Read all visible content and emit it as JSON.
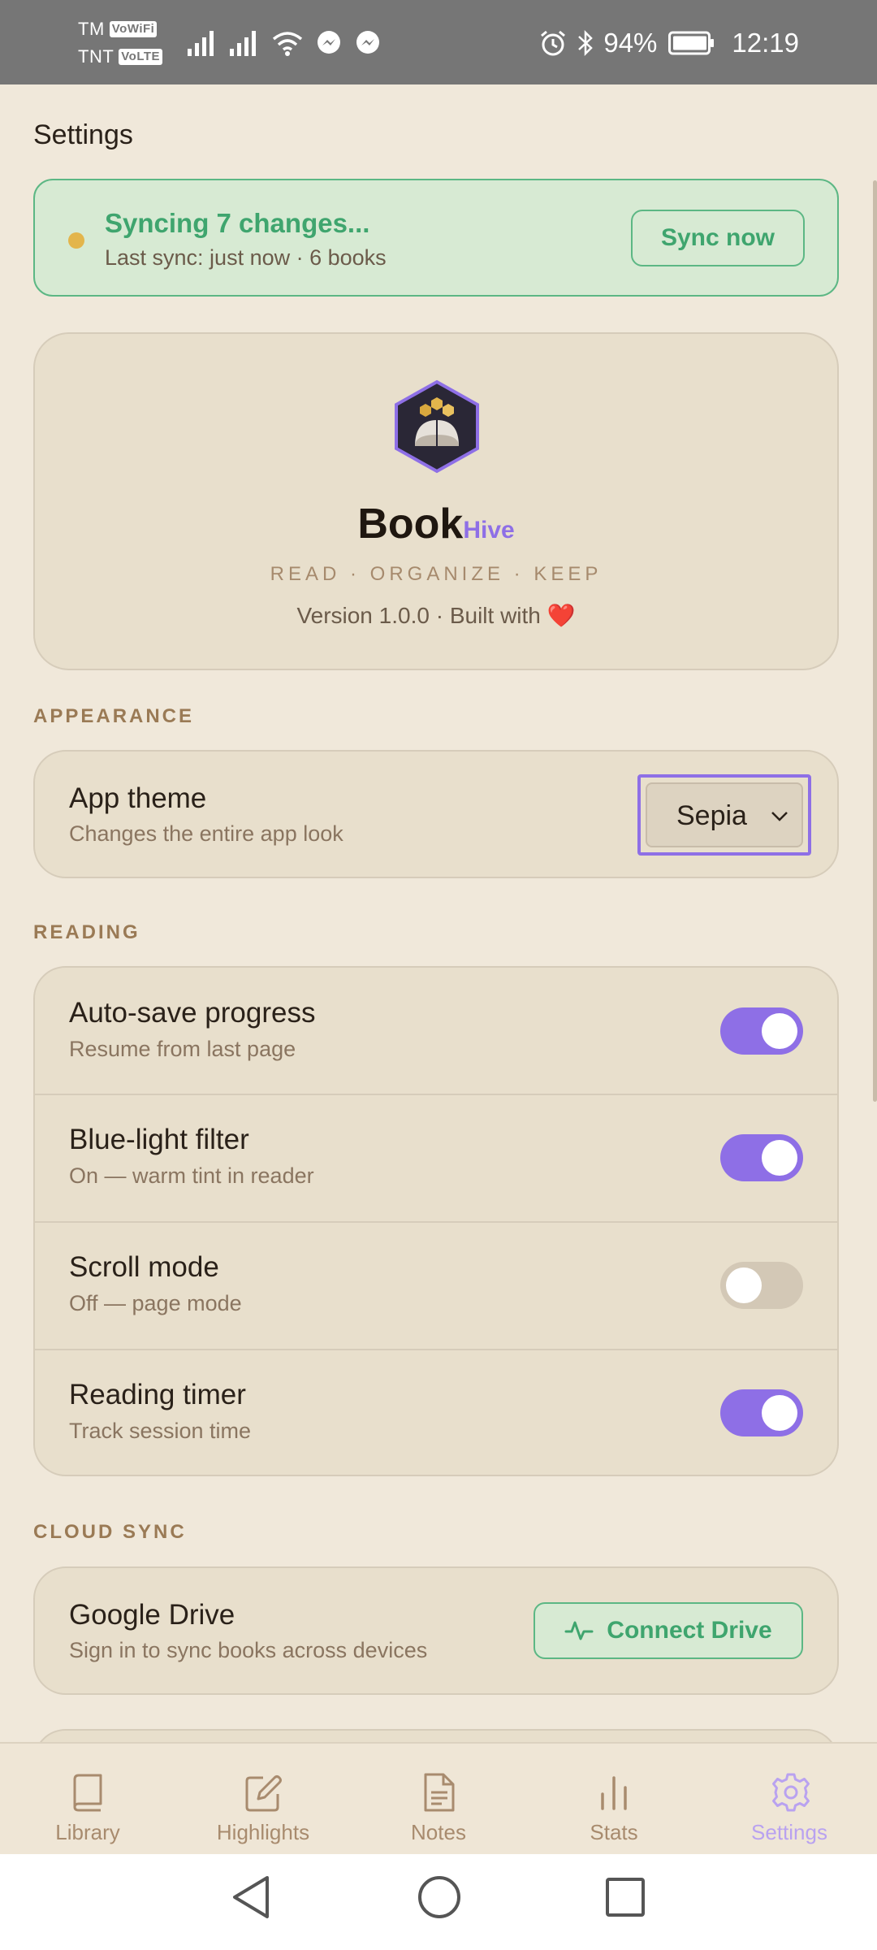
{
  "status_bar": {
    "carriers": [
      {
        "name": "TM",
        "badge": "VoWiFi"
      },
      {
        "name": "TNT",
        "badge": "VoLTE"
      }
    ],
    "battery": "94%",
    "time": "12:19"
  },
  "page_title": "Settings",
  "sync": {
    "title": "Syncing 7 changes...",
    "subtitle": "Last sync: just now · 6 books",
    "button_label": "Sync now"
  },
  "about": {
    "brand_main": "Book",
    "brand_sub": "Hive",
    "tagline": "READ · ORGANIZE · KEEP",
    "version_text": "Version 1.0.0 · Built with"
  },
  "appearance": {
    "header": "APPEARANCE",
    "theme_title": "App theme",
    "theme_subtitle": "Changes the entire app look",
    "theme_value": "Sepia"
  },
  "reading": {
    "header": "READING",
    "items": [
      {
        "title": "Auto-save progress",
        "subtitle": "Resume from last page",
        "enabled": true
      },
      {
        "title": "Blue-light filter",
        "subtitle": "On — warm tint in reader",
        "enabled": true
      },
      {
        "title": "Scroll mode",
        "subtitle": "Off — page mode",
        "enabled": false
      },
      {
        "title": "Reading timer",
        "subtitle": "Track session time",
        "enabled": true
      }
    ]
  },
  "cloud_sync": {
    "header": "CLOUD SYNC",
    "title": "Google Drive",
    "subtitle": "Sign in to sync books across devices",
    "button_label": "Connect Drive"
  },
  "nav": {
    "active": "Settings",
    "items": [
      {
        "label": "Library",
        "icon": "book-icon"
      },
      {
        "label": "Highlights",
        "icon": "edit-icon"
      },
      {
        "label": "Notes",
        "icon": "document-icon"
      },
      {
        "label": "Stats",
        "icon": "bar-chart-icon"
      },
      {
        "label": "Settings",
        "icon": "gear-icon"
      }
    ]
  },
  "colors": {
    "accent": "#8e6fe6",
    "sync_green": "#3fa56e",
    "background": "#f0e8da",
    "card": "#e8dfcc",
    "sync_dot": "#e3b54c"
  }
}
